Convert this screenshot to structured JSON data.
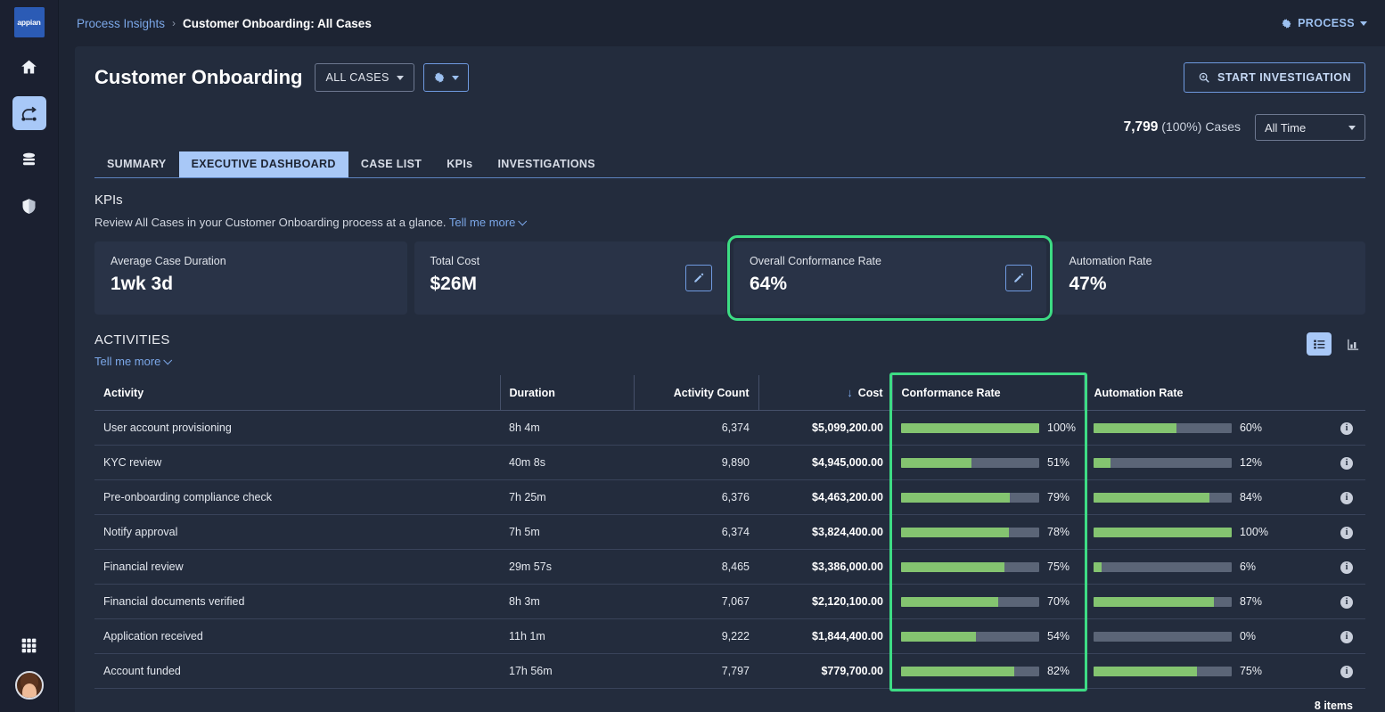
{
  "rail": {
    "logo_text": "appian",
    "items": [
      {
        "name": "home-icon",
        "label": "Home"
      },
      {
        "name": "process-icon",
        "label": "Process Insights"
      },
      {
        "name": "data-icon",
        "label": "Data"
      },
      {
        "name": "security-icon",
        "label": "Security"
      }
    ],
    "apps_label": "Apps",
    "avatar_label": "User profile"
  },
  "topbar": {
    "breadcrumb_parent": "Process Insights",
    "breadcrumb_sep": "›",
    "breadcrumb_current": "Customer Onboarding: All Cases",
    "process_menu_label": "PROCESS"
  },
  "header": {
    "title": "Customer Onboarding",
    "all_cases_label": "ALL CASES",
    "gear_label": "Settings",
    "start_investigation_label": "START INVESTIGATION"
  },
  "countrow": {
    "count": "7,799",
    "percent": "(100%)",
    "cases_label": "Cases",
    "time_filter": "All Time"
  },
  "tabs": [
    {
      "label": "SUMMARY",
      "active": false
    },
    {
      "label": "EXECUTIVE DASHBOARD",
      "active": true
    },
    {
      "label": "CASE LIST",
      "active": false
    },
    {
      "label": "KPIs",
      "active": false
    },
    {
      "label": "INVESTIGATIONS",
      "active": false
    }
  ],
  "kpis": {
    "section_title": "KPIs",
    "subtitle": "Review All Cases in your Customer Onboarding process at a glance.",
    "tell_me_more": "Tell me more",
    "cards": [
      {
        "label": "Average Case Duration",
        "value": "1wk 3d",
        "editable": false,
        "highlighted": false
      },
      {
        "label": "Total Cost",
        "value": "$26M",
        "editable": true,
        "highlighted": false
      },
      {
        "label": "Overall Conformance Rate",
        "value": "64%",
        "editable": true,
        "highlighted": true
      },
      {
        "label": "Automation Rate",
        "value": "47%",
        "editable": false,
        "highlighted": false
      }
    ]
  },
  "activities": {
    "section_title": "ACTIVITIES",
    "tell_me_more": "Tell me more",
    "view_list_label": "List view",
    "view_chart_label": "Chart view",
    "columns": [
      "Activity",
      "Duration",
      "Activity Count",
      "Cost",
      "Conformance Rate",
      "Automation Rate"
    ],
    "sort": {
      "column": "Cost",
      "direction": "desc",
      "glyph": "↓"
    },
    "rows": [
      {
        "activity": "User account provisioning",
        "duration": "8h 4m",
        "count": "6,374",
        "cost": "$5,099,200.00",
        "conformance": 100,
        "conformance_label": "100%",
        "automation": 60,
        "automation_label": "60%"
      },
      {
        "activity": "KYC review",
        "duration": "40m 8s",
        "count": "9,890",
        "cost": "$4,945,000.00",
        "conformance": 51,
        "conformance_label": "51%",
        "automation": 12,
        "automation_label": "12%"
      },
      {
        "activity": "Pre-onboarding compliance check",
        "duration": "7h 25m",
        "count": "6,376",
        "cost": "$4,463,200.00",
        "conformance": 79,
        "conformance_label": "79%",
        "automation": 84,
        "automation_label": "84%"
      },
      {
        "activity": "Notify approval",
        "duration": "7h 5m",
        "count": "6,374",
        "cost": "$3,824,400.00",
        "conformance": 78,
        "conformance_label": "78%",
        "automation": 100,
        "automation_label": "100%"
      },
      {
        "activity": "Financial review",
        "duration": "29m 57s",
        "count": "8,465",
        "cost": "$3,386,000.00",
        "conformance": 75,
        "conformance_label": "75%",
        "automation": 6,
        "automation_label": "6%"
      },
      {
        "activity": "Financial documents verified",
        "duration": "8h 3m",
        "count": "7,067",
        "cost": "$2,120,100.00",
        "conformance": 70,
        "conformance_label": "70%",
        "automation": 87,
        "automation_label": "87%"
      },
      {
        "activity": "Application received",
        "duration": "11h 1m",
        "count": "9,222",
        "cost": "$1,844,400.00",
        "conformance": 54,
        "conformance_label": "54%",
        "automation": 0,
        "automation_label": "0%"
      },
      {
        "activity": "Account funded",
        "duration": "17h 56m",
        "count": "7,797",
        "cost": "$779,700.00",
        "conformance": 82,
        "conformance_label": "82%",
        "automation": 75,
        "automation_label": "75%"
      }
    ],
    "items_count": "8 items",
    "info_glyph": "i"
  },
  "colors": {
    "accent_blue": "#a8c8f7",
    "link_blue": "#7ba7e8",
    "highlight_green": "#3ddc84",
    "bar_green": "#84c470",
    "bar_track": "#5b6577",
    "panel_bg": "#232c3d",
    "card_bg": "#293347",
    "page_bg": "#1d2433"
  }
}
